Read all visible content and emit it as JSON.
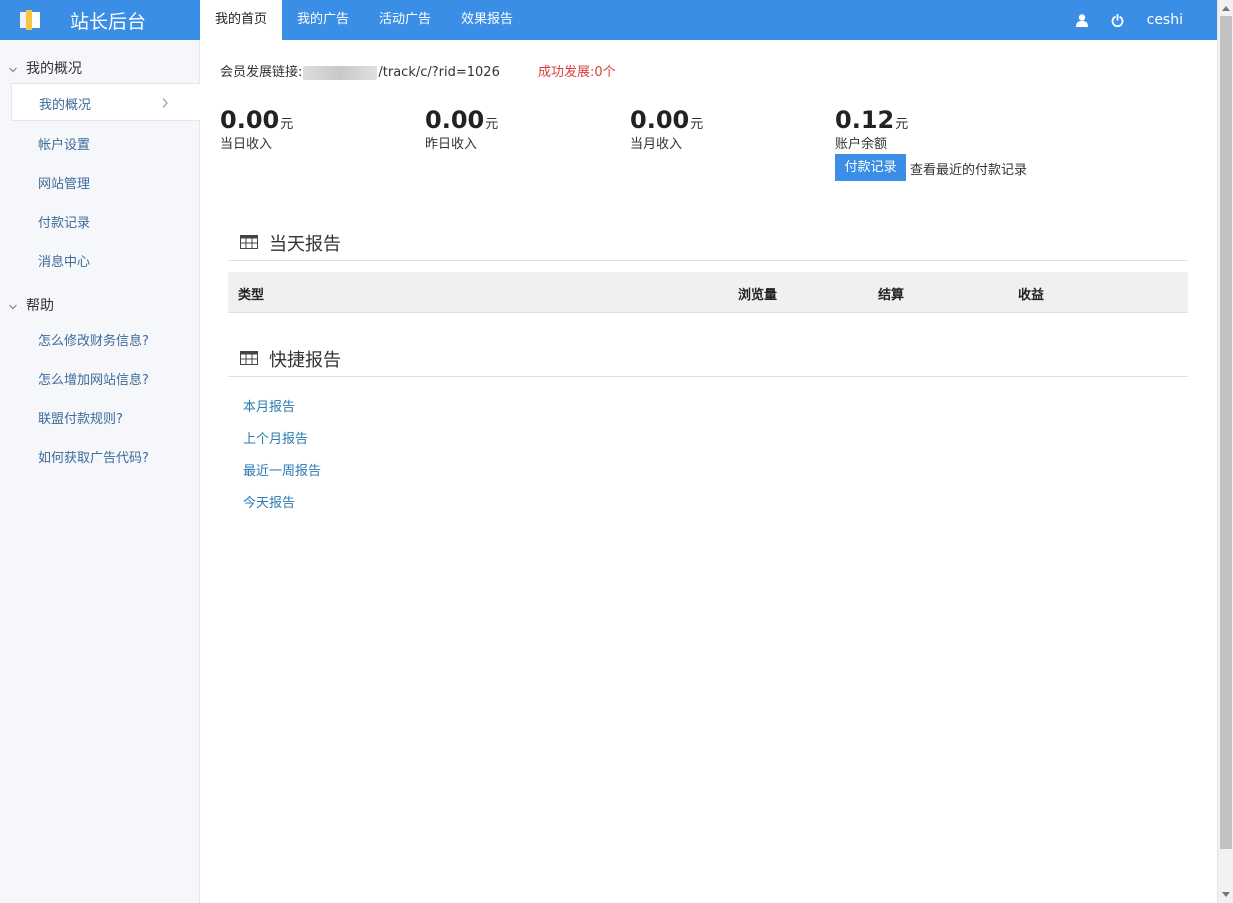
{
  "app": {
    "title": "站长后台",
    "logo_icon": "book-icon",
    "accent_color": "#3a8ee6"
  },
  "nav": {
    "items": [
      {
        "label": "我的首页",
        "active": true
      },
      {
        "label": "我的广告",
        "active": false
      },
      {
        "label": "活动广告",
        "active": false
      },
      {
        "label": "效果报告",
        "active": false
      }
    ]
  },
  "user": {
    "username": "ceshi",
    "icons": [
      "user-icon",
      "power-icon"
    ]
  },
  "sidebar": {
    "groups": [
      {
        "label": "我的概况",
        "items": [
          {
            "label": "我的概况",
            "active": true
          },
          {
            "label": "帐户设置"
          },
          {
            "label": "网站管理"
          },
          {
            "label": "付款记录"
          },
          {
            "label": "消息中心"
          }
        ]
      },
      {
        "label": "帮助",
        "items": [
          {
            "label": "怎么修改财务信息?"
          },
          {
            "label": "怎么增加网站信息?"
          },
          {
            "label": "联盟付款规则?"
          },
          {
            "label": "如何获取广告代码?"
          }
        ]
      }
    ]
  },
  "main": {
    "track": {
      "label": "会员发展链接:",
      "url_suffix": "/track/c/?rid=1026",
      "success_text": "成功发展:0个",
      "success_color": "#d9403b"
    },
    "stats": [
      {
        "value": "0.00",
        "unit": "元",
        "caption": "当日收入"
      },
      {
        "value": "0.00",
        "unit": "元",
        "caption": "昨日收入"
      },
      {
        "value": "0.00",
        "unit": "元",
        "caption": "当月收入"
      },
      {
        "value": "0.12",
        "unit": "元",
        "caption": "账户余额"
      }
    ],
    "payment": {
      "button_label": "付款记录",
      "description": "查看最近的付款记录"
    },
    "today_report": {
      "title": "当天报告",
      "columns": [
        "类型",
        "浏览量",
        "结算",
        "收益"
      ],
      "rows": []
    },
    "quick_report": {
      "title": "快捷报告",
      "links": [
        "本月报告",
        "上个月报告",
        "最近一周报告",
        "今天报告"
      ]
    }
  }
}
